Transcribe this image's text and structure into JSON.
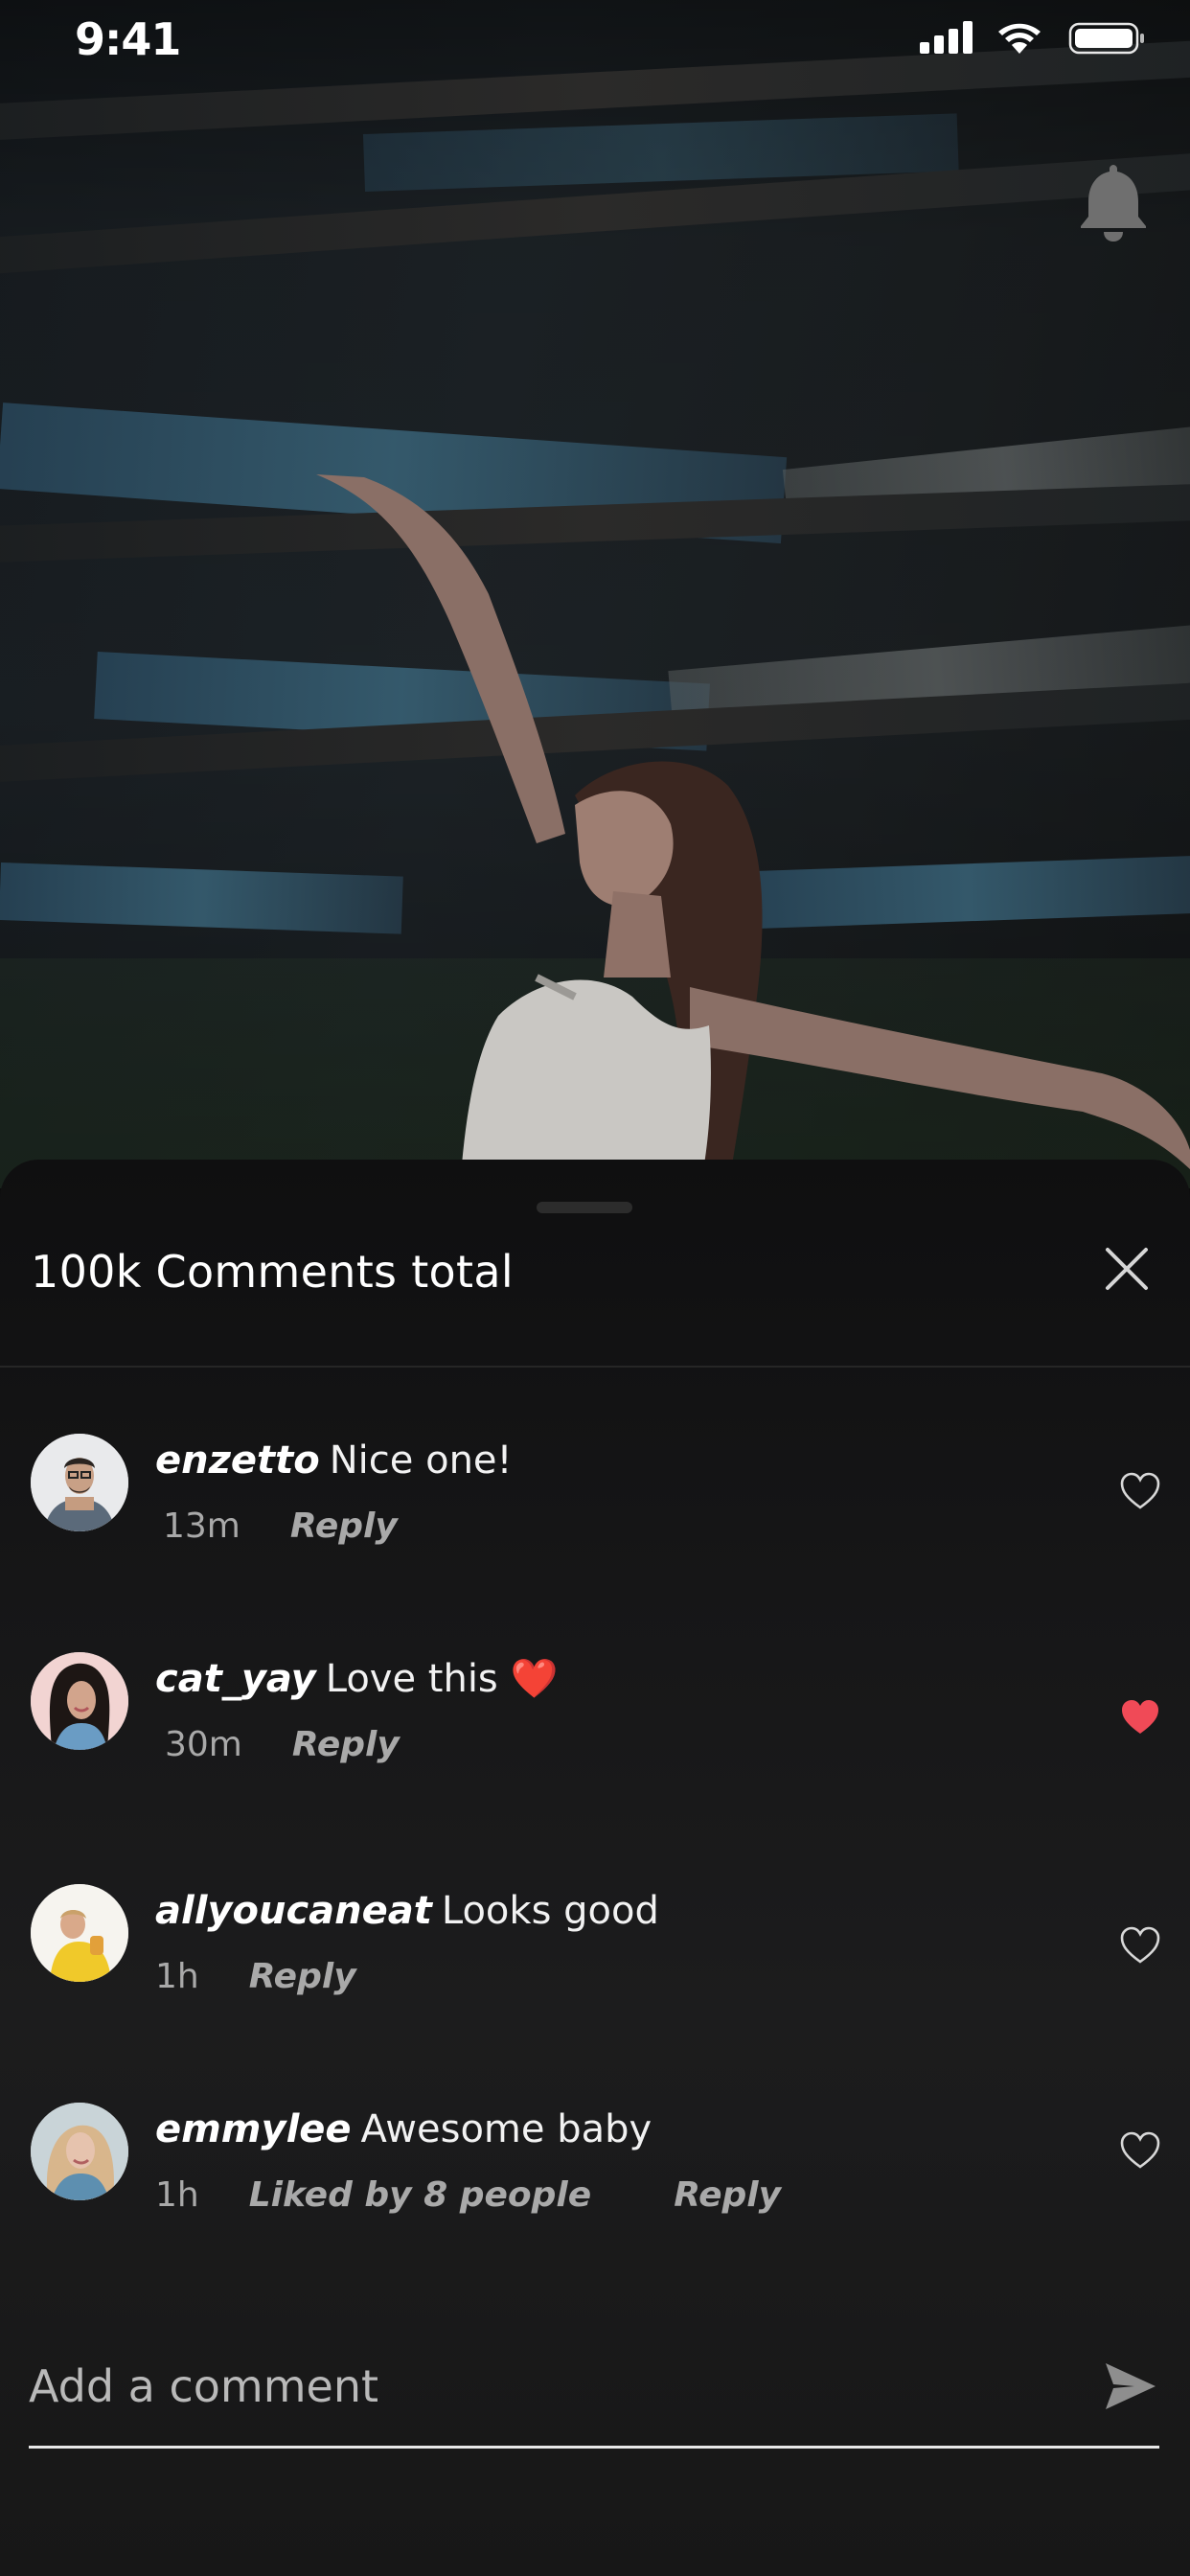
{
  "status_bar": {
    "time": "9:41"
  },
  "sheet": {
    "title": "100k Comments total"
  },
  "comments": [
    {
      "username": "enzetto",
      "text": "Nice one!",
      "time_ago": "13m",
      "liked_by": "",
      "reply_label": "Reply",
      "liked": false
    },
    {
      "username": "cat_yay",
      "text": "Love this ❤️",
      "time_ago": "30m",
      "liked_by": "",
      "reply_label": "Reply",
      "liked": true
    },
    {
      "username": "allyoucaneat",
      "text": "Looks good",
      "time_ago": "1h",
      "liked_by": "",
      "reply_label": "Reply",
      "liked": false
    },
    {
      "username": "emmylee",
      "text": "Awesome baby",
      "time_ago": "1h",
      "liked_by": "Liked by 8 people",
      "reply_label": "Reply",
      "liked": false
    }
  ],
  "composer": {
    "placeholder": "Add a comment"
  },
  "colors": {
    "heart_active": "#f04a57",
    "sheet_bg": "#161617",
    "muted_text": "#a9a9a9"
  },
  "icons": {
    "bell": "bell-icon",
    "close": "close-icon",
    "heart": "heart-icon",
    "send": "send-icon"
  }
}
